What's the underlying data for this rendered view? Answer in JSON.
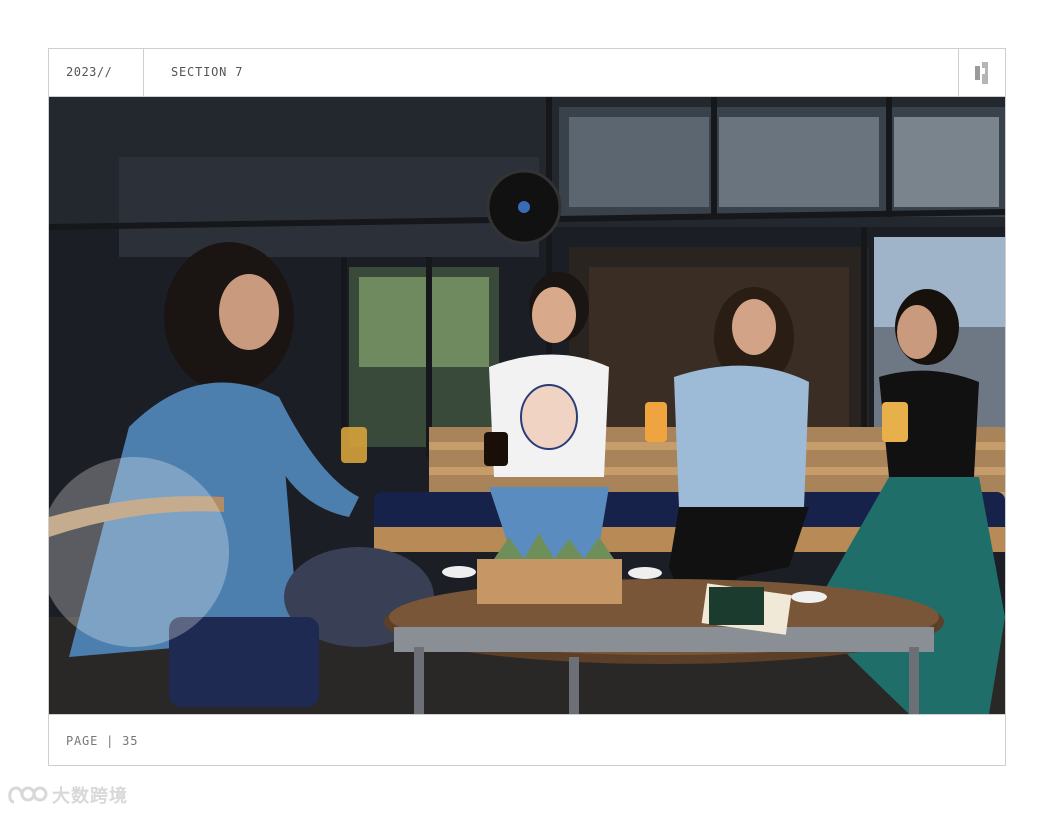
{
  "header": {
    "year": "2023//",
    "section": "SECTION 7"
  },
  "photo": {
    "icon": "photo-of-four-women-laughing-at-cafe-table"
  },
  "footer": {
    "page_label": "PAGE | 35"
  },
  "watermark": {
    "text": "大数跨境",
    "icon": "watermark-logo-icon"
  },
  "colors": {
    "border": "#cfcfcf",
    "text": "#555555"
  }
}
